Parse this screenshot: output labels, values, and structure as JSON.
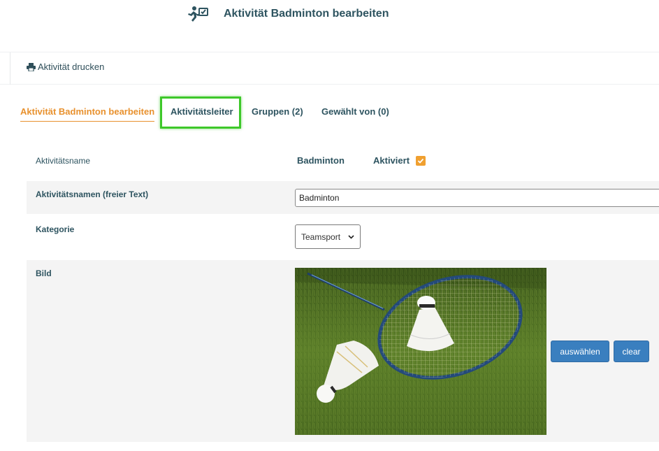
{
  "header": {
    "title": "Aktivität Badminton bearbeiten",
    "icon": "running-person-icon"
  },
  "toolbar": {
    "print_label": "Aktivität drucken",
    "print_icon": "printer-icon"
  },
  "tabs": [
    {
      "label": "Aktivität Badminton bearbeiten",
      "active": true
    },
    {
      "label": "Aktivitätsleiter",
      "active": false
    },
    {
      "label": "Gruppen (2)",
      "active": false
    },
    {
      "label": "Gewählt von (0)",
      "active": false
    }
  ],
  "form": {
    "name_label": "Aktivitätsname",
    "name_value": "Badminton",
    "activated_label": "Aktiviert",
    "activated_checked": true,
    "freetext_label": "Aktivitätsnamen (freier Text)",
    "freetext_value": "Badminton",
    "category_label": "Kategorie",
    "category_value": "Teamsport",
    "image_label": "Bild",
    "choose_button": "auswählen",
    "clear_button": "clear"
  },
  "colors": {
    "accent": "#e8912e",
    "primary_text": "#2e5460",
    "button": "#3a7fbf",
    "highlight": "#3ec82a"
  }
}
